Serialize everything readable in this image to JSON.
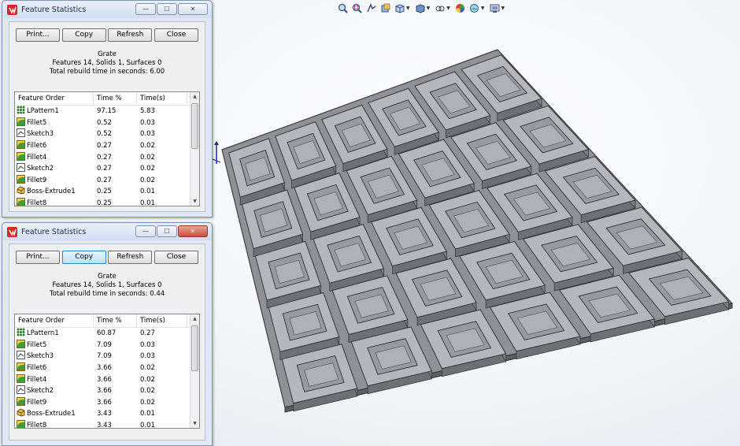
{
  "toolbar": {
    "icons": [
      "zoom-to-fit-icon",
      "zoom-area-icon",
      "previous-view-icon",
      "section-view-icon",
      "view-orientation-icon",
      "display-style-icon",
      "hide-show-items-icon",
      "edit-appearance-icon",
      "apply-scene-icon",
      "view-settings-icon"
    ]
  },
  "dialogs": [
    {
      "title": "Feature Statistics",
      "buttons": {
        "print": "Print...",
        "copy": "Copy",
        "refresh": "Refresh",
        "close": "Close"
      },
      "part_name": "Grate",
      "summary": "Features 14, Solids 1, Surfaces 0",
      "rebuild_time": "Total rebuild time in seconds: 6.00",
      "columns": [
        "Feature Order",
        "Time %",
        "Time(s)"
      ],
      "rows": [
        {
          "name": "LPattern1",
          "pct": "97.15",
          "time": "5.83",
          "icon": "pattern"
        },
        {
          "name": "Fillet5",
          "pct": "0.52",
          "time": "0.03",
          "icon": "fillet"
        },
        {
          "name": "Sketch3",
          "pct": "0.52",
          "time": "0.03",
          "icon": "sketch"
        },
        {
          "name": "Fillet6",
          "pct": "0.27",
          "time": "0.02",
          "icon": "fillet"
        },
        {
          "name": "Fillet4",
          "pct": "0.27",
          "time": "0.02",
          "icon": "fillet"
        },
        {
          "name": "Sketch2",
          "pct": "0.27",
          "time": "0.02",
          "icon": "sketch"
        },
        {
          "name": "Fillet9",
          "pct": "0.27",
          "time": "0.02",
          "icon": "fillet"
        },
        {
          "name": "Boss-Extrude1",
          "pct": "0.25",
          "time": "0.01",
          "icon": "extrude"
        },
        {
          "name": "Fillet8",
          "pct": "0.25",
          "time": "0.01",
          "icon": "fillet"
        }
      ]
    },
    {
      "title": "Feature Statistics",
      "buttons": {
        "print": "Print...",
        "copy": "Copy",
        "refresh": "Refresh",
        "close": "Close"
      },
      "part_name": "Grate",
      "summary": "Features 14, Solids 1, Surfaces 0",
      "rebuild_time": "Total rebuild time in seconds: 0.44",
      "columns": [
        "Feature Order",
        "Time %",
        "Time(s)"
      ],
      "rows": [
        {
          "name": "LPattern1",
          "pct": "60.87",
          "time": "0.27",
          "icon": "pattern"
        },
        {
          "name": "Fillet5",
          "pct": "7.09",
          "time": "0.03",
          "icon": "fillet"
        },
        {
          "name": "Sketch3",
          "pct": "7.09",
          "time": "0.03",
          "icon": "sketch"
        },
        {
          "name": "Fillet6",
          "pct": "3.66",
          "time": "0.02",
          "icon": "fillet"
        },
        {
          "name": "Fillet4",
          "pct": "3.66",
          "time": "0.02",
          "icon": "fillet"
        },
        {
          "name": "Sketch2",
          "pct": "3.66",
          "time": "0.02",
          "icon": "sketch"
        },
        {
          "name": "Fillet9",
          "pct": "3.66",
          "time": "0.02",
          "icon": "fillet"
        },
        {
          "name": "Boss-Extrude1",
          "pct": "3.43",
          "time": "0.01",
          "icon": "extrude"
        },
        {
          "name": "Fillet8",
          "pct": "3.43",
          "time": "0.01",
          "icon": "fillet"
        }
      ]
    }
  ],
  "model": {
    "grid_cols": 6,
    "grid_rows": 5
  }
}
